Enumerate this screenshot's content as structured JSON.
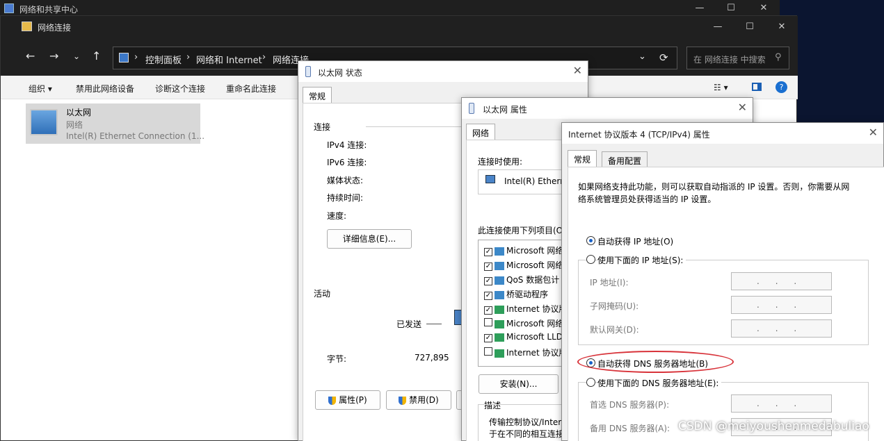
{
  "back_window": {
    "title": "网络和共享中心"
  },
  "explorer": {
    "title": "网络连接",
    "breadcrumb": [
      "控制面板",
      "网络和 Internet",
      "网络连接"
    ],
    "search_placeholder": "在 网络连接 中搜索",
    "toolbar": {
      "organize": "组织",
      "disable": "禁用此网络设备",
      "diagnose": "诊断这个连接",
      "rename": "重命名此连接"
    },
    "item": {
      "name": "以太网",
      "type": "网络",
      "adapter": "Intel(R) Ethernet Connection (1..."
    }
  },
  "status_dialog": {
    "title": "以太网 状态",
    "tab": "常规",
    "section_connection": "连接",
    "fields": [
      "IPv4 连接:",
      "IPv6 连接:",
      "媒体状态:",
      "持续时间:",
      "速度:"
    ],
    "details_button": "详细信息(E)...",
    "section_activity": "活动",
    "sent_label": "已发送",
    "bytes_label": "字节:",
    "bytes_value": "727,895",
    "properties_button": "属性(P)",
    "disable_button": "禁用(D)"
  },
  "props_dialog": {
    "title": "以太网 属性",
    "tab": "网络",
    "connect_using": "连接时使用:",
    "adapter": "Intel(R) Etherne",
    "items_header": "此连接使用下列项目(O",
    "items": [
      {
        "checked": true,
        "label": "Microsoft 网络"
      },
      {
        "checked": true,
        "label": "Microsoft 网络"
      },
      {
        "checked": true,
        "label": "QoS 数据包计"
      },
      {
        "checked": true,
        "label": "桥驱动程序"
      },
      {
        "checked": true,
        "label": "Internet 协议版"
      },
      {
        "checked": false,
        "label": "Microsoft 网络"
      },
      {
        "checked": true,
        "label": "Microsoft LLD"
      },
      {
        "checked": false,
        "label": "Internet 协议版"
      }
    ],
    "install_button": "安装(N)...",
    "desc_header": "描述",
    "desc_line1": "传输控制协议/Intern",
    "desc_line2": "于在不同的相互连接"
  },
  "ipv4_dialog": {
    "title": "Internet 协议版本 4 (TCP/IPv4) 属性",
    "tabs": [
      "常规",
      "备用配置"
    ],
    "intro_line1": "如果网络支持此功能，则可以获取自动指派的 IP 设置。否则，你需要从网",
    "intro_line2": "络系统管理员处获得适当的 IP 设置。",
    "auto_ip": "自动获得 IP 地址(O)",
    "manual_ip": "使用下面的 IP 地址(S):",
    "ip_label": "IP 地址(I):",
    "mask_label": "子网掩码(U):",
    "gateway_label": "默认网关(D):",
    "ip_dots": ".      .      .",
    "auto_dns": "自动获得 DNS 服务器地址(B)",
    "manual_dns": "使用下面的 DNS 服务器地址(E):",
    "pref_dns": "首选 DNS 服务器(P):",
    "alt_dns": "备用 DNS 服务器(A):"
  },
  "watermark": "CSDN @meiyoushenmedabuliao"
}
